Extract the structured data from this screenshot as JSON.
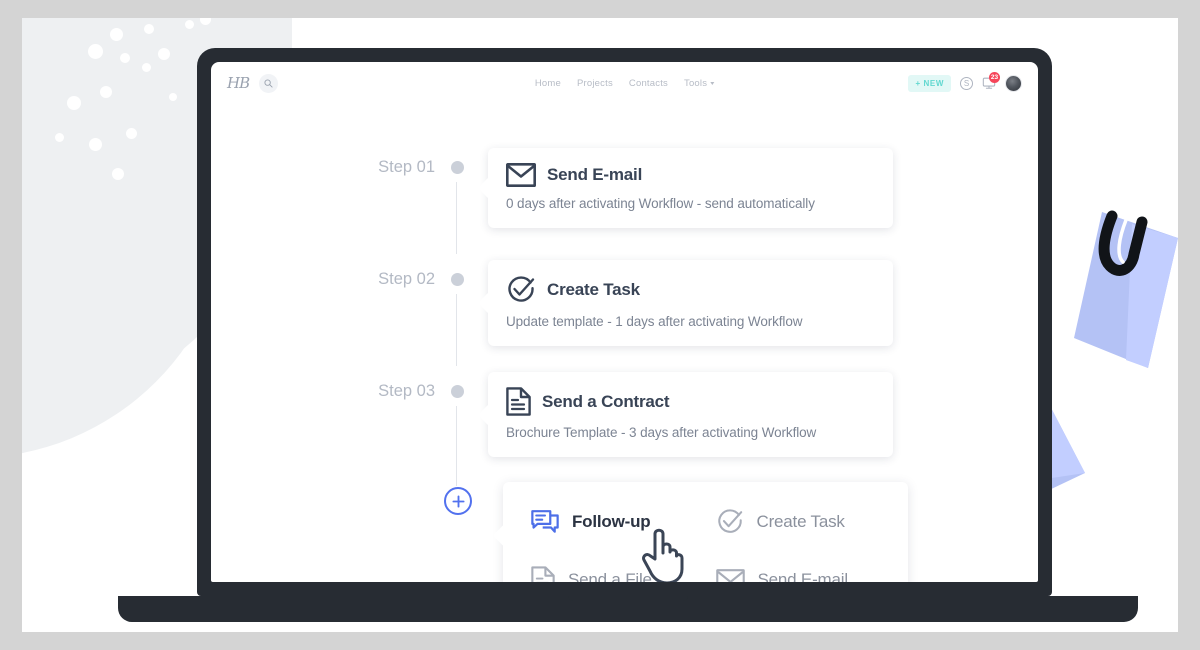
{
  "app": {
    "logo_text": "HB",
    "search_icon": "search-icon"
  },
  "nav": {
    "items": [
      {
        "label": "Home"
      },
      {
        "label": "Projects"
      },
      {
        "label": "Contacts"
      },
      {
        "label": "Tools",
        "has_dropdown": true
      }
    ]
  },
  "actions": {
    "new_button_label": "+ NEW",
    "money_icon_glyph": "S",
    "notifications_badge": "23",
    "avatar": "user-avatar"
  },
  "workflow": {
    "steps": [
      {
        "step_label": "Step 01",
        "icon": "envelope-icon",
        "title": "Send E-mail",
        "subtitle": "0 days after activating Workflow - send automatically"
      },
      {
        "step_label": "Step 02",
        "icon": "check-circle-icon",
        "title": "Create Task",
        "subtitle": "Update template - 1 days after activating Workflow"
      },
      {
        "step_label": "Step 03",
        "icon": "document-icon",
        "title": "Send a Contract",
        "subtitle": "Brochure Template - 3 days after activating Workflow"
      }
    ],
    "add_step_button": "add-step-button",
    "menu": {
      "options": [
        {
          "label": "Follow-up",
          "icon": "chat-bubbles-icon",
          "active": true
        },
        {
          "label": "Create Task",
          "icon": "check-circle-icon",
          "active": false
        },
        {
          "label": "Send a File",
          "icon": "document-icon",
          "active": false
        },
        {
          "label": "Send E-mail",
          "icon": "envelope-icon",
          "active": false
        }
      ]
    }
  },
  "colors": {
    "accent_blue": "#5271ee",
    "mint": "#62d8d0",
    "badge_red": "#f6455a",
    "device_dark": "#272c33",
    "title_gray": "#394456",
    "muted_gray": "#b3b9c4",
    "illustration_blue": "#b4c2f5"
  },
  "decoration": {
    "illustrations": [
      "speech-bubble",
      "paperclip-document",
      "flying-envelope"
    ]
  }
}
